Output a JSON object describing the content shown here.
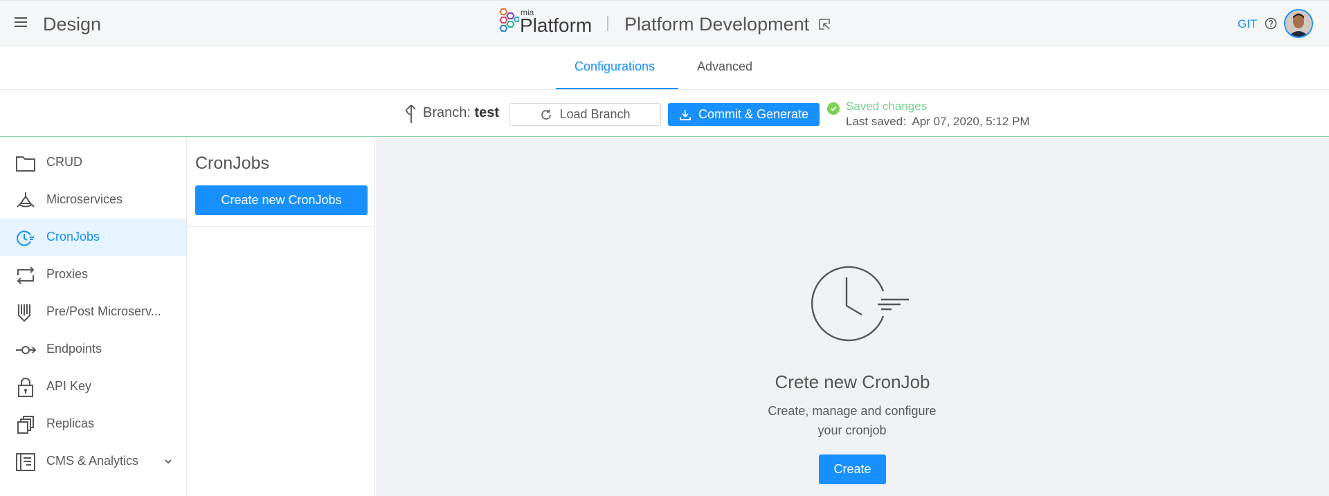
{
  "header": {
    "app_title": "Design",
    "brand_small": "mia",
    "brand_large": "Platform",
    "project_name": "Platform Development",
    "git_label": "GIT"
  },
  "tabs": [
    {
      "label": "Configurations",
      "active": true
    },
    {
      "label": "Advanced",
      "active": false
    }
  ],
  "branch_bar": {
    "branch_prefix": "Branch:",
    "branch_name": "test",
    "load_button": "Load Branch",
    "commit_button": "Commit & Generate",
    "saved_status": "Saved changes",
    "last_saved_label": "Last saved:",
    "last_saved_value": "Apr 07, 2020, 5:12 PM"
  },
  "sidebar": {
    "items": [
      {
        "label": "CRUD",
        "icon": "folder-icon"
      },
      {
        "label": "Microservices",
        "icon": "microservices-icon"
      },
      {
        "label": "CronJobs",
        "icon": "cronjob-clock-icon",
        "active": true
      },
      {
        "label": "Proxies",
        "icon": "proxies-arrows-icon"
      },
      {
        "label": "Pre/Post Microserv...",
        "icon": "pre-post-icon"
      },
      {
        "label": "Endpoints",
        "icon": "endpoints-icon"
      },
      {
        "label": "API Key",
        "icon": "lock-icon"
      },
      {
        "label": "Replicas",
        "icon": "replicas-icon"
      },
      {
        "label": "CMS & Analytics",
        "icon": "cms-icon"
      }
    ]
  },
  "middle_panel": {
    "title": "CronJobs",
    "create_button": "Create new CronJobs"
  },
  "empty_state": {
    "title": "Crete new CronJob",
    "description": "Create, manage and configure your cronjob",
    "create_button": "Create"
  },
  "colors": {
    "accent": "#1890ff",
    "saved_green": "#73d18a",
    "active_bg": "#e6f4ff"
  }
}
